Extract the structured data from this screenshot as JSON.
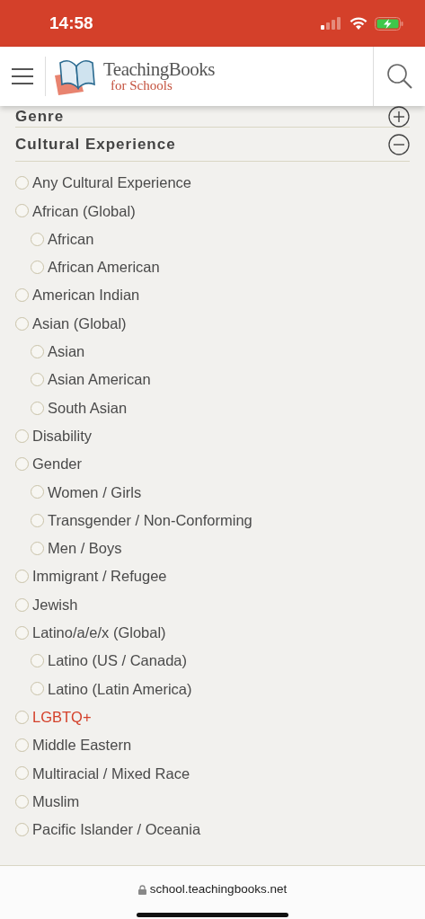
{
  "status_bar": {
    "time": "14:58"
  },
  "header": {
    "logo_title": "TeachingBooks",
    "logo_subtitle": "for Schools"
  },
  "sections": [
    {
      "title": "Genre",
      "expanded": false
    },
    {
      "title": "Cultural Experience",
      "expanded": true,
      "options": [
        {
          "label": "Any Cultural Experience",
          "selected": false,
          "highlighted": false
        },
        {
          "label": "African (Global)",
          "selected": false,
          "highlighted": false,
          "children": [
            {
              "label": "African",
              "selected": false,
              "highlighted": false
            },
            {
              "label": "African American",
              "selected": false,
              "highlighted": false
            }
          ]
        },
        {
          "label": "American Indian",
          "selected": false,
          "highlighted": false
        },
        {
          "label": "Asian (Global)",
          "selected": false,
          "highlighted": false,
          "children": [
            {
              "label": "Asian",
              "selected": false,
              "highlighted": false
            },
            {
              "label": "Asian American",
              "selected": false,
              "highlighted": false
            },
            {
              "label": "South Asian",
              "selected": false,
              "highlighted": false
            }
          ]
        },
        {
          "label": "Disability",
          "selected": false,
          "highlighted": false
        },
        {
          "label": "Gender",
          "selected": false,
          "highlighted": false,
          "children": [
            {
              "label": "Women / Girls",
              "selected": false,
              "highlighted": false
            },
            {
              "label": "Transgender / Non-Conforming",
              "selected": false,
              "highlighted": false
            },
            {
              "label": "Men / Boys",
              "selected": false,
              "highlighted": false
            }
          ]
        },
        {
          "label": "Immigrant / Refugee",
          "selected": false,
          "highlighted": false
        },
        {
          "label": "Jewish",
          "selected": false,
          "highlighted": false
        },
        {
          "label": "Latino/a/e/x (Global)",
          "selected": false,
          "highlighted": false,
          "children": [
            {
              "label": "Latino (US / Canada)",
              "selected": false,
              "highlighted": false
            },
            {
              "label": "Latino (Latin America)",
              "selected": false,
              "highlighted": false
            }
          ]
        },
        {
          "label": "LGBTQ+",
          "selected": false,
          "highlighted": true
        },
        {
          "label": "Middle Eastern",
          "selected": false,
          "highlighted": false
        },
        {
          "label": "Multiracial / Mixed Race",
          "selected": false,
          "highlighted": false
        },
        {
          "label": "Muslim",
          "selected": false,
          "highlighted": false
        },
        {
          "label": "Pacific Islander / Oceania",
          "selected": false,
          "highlighted": false
        }
      ]
    }
  ],
  "browser_bar": {
    "url": "school.teachingbooks.net"
  }
}
